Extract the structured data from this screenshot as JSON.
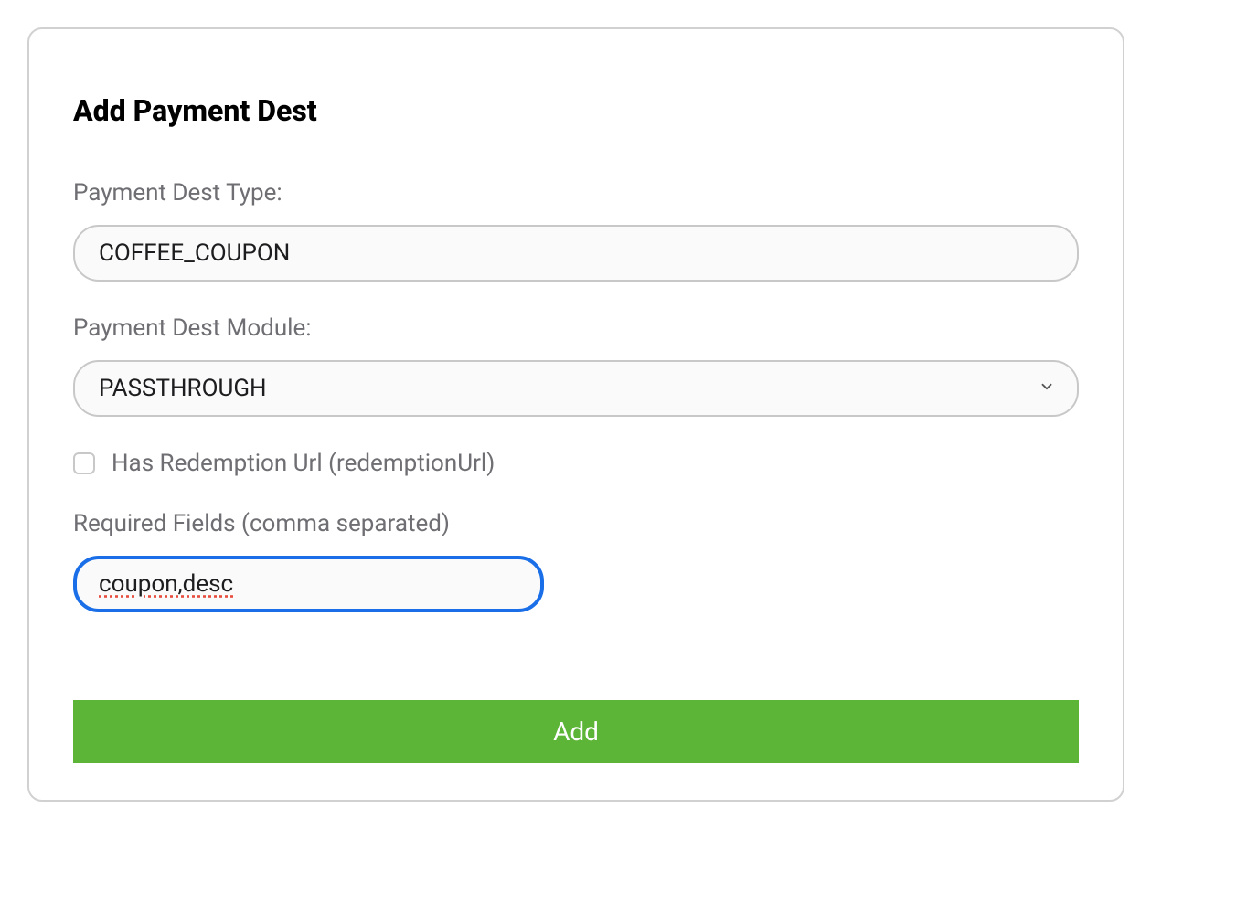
{
  "panel": {
    "title": "Add Payment Dest",
    "fields": {
      "dest_type": {
        "label": "Payment Dest Type:",
        "value": "COFFEE_COUPON"
      },
      "dest_module": {
        "label": "Payment Dest Module:",
        "value": "PASSTHROUGH"
      },
      "has_redemption_url": {
        "label": "Has Redemption Url (redemptionUrl)",
        "checked": false
      },
      "required_fields": {
        "label": "Required Fields (comma separated)",
        "value": "coupon,desc"
      }
    },
    "add_button_label": "Add"
  }
}
